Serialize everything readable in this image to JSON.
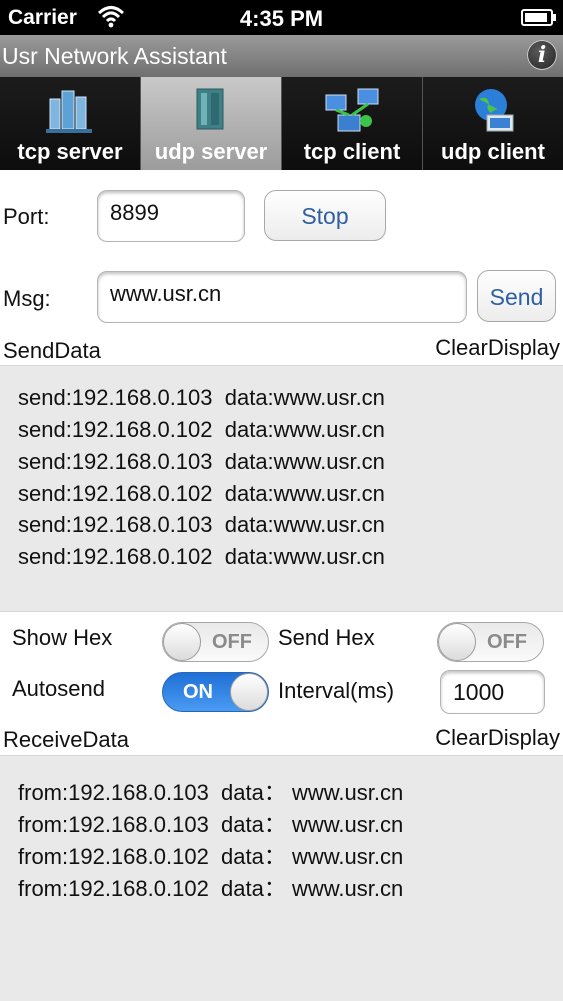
{
  "status": {
    "carrier": "Carrier",
    "time": "4:35 PM"
  },
  "app": {
    "title": "Usr Network Assistant"
  },
  "tabs": [
    {
      "label": "tcp server",
      "icon": "server-rack-icon",
      "active": false
    },
    {
      "label": "udp server",
      "icon": "server-tower-icon",
      "active": true
    },
    {
      "label": "tcp client",
      "icon": "network-computers-icon",
      "active": false
    },
    {
      "label": "udp client",
      "icon": "globe-computer-icon",
      "active": false
    }
  ],
  "form": {
    "port_label": "Port:",
    "port_value": "8899",
    "stop_label": "Stop",
    "msg_label": "Msg:",
    "msg_value": "www.usr.cn",
    "send_label": "Send",
    "send_data_label": "SendData",
    "clear_display_send": "ClearDisplay"
  },
  "send_log": [
    "send:192.168.0.103  data:www.usr.cn",
    "send:192.168.0.102  data:www.usr.cn",
    "send:192.168.0.103  data:www.usr.cn",
    "send:192.168.0.102  data:www.usr.cn",
    "send:192.168.0.103  data:www.usr.cn",
    "send:192.168.0.102  data:www.usr.cn"
  ],
  "options": {
    "show_hex_label": "Show Hex",
    "show_hex_state": "OFF",
    "send_hex_label": "Send Hex",
    "send_hex_state": "OFF",
    "autosend_label": "Autosend",
    "autosend_state": "ON",
    "interval_label": "Interval(ms)",
    "interval_value": "1000"
  },
  "receive": {
    "label": "ReceiveData",
    "clear_display": "ClearDisplay",
    "log": [
      "from:192.168.0.103  data： www.usr.cn",
      "from:192.168.0.103  data： www.usr.cn",
      "from:192.168.0.102  data： www.usr.cn",
      "from:192.168.0.102  data： www.usr.cn"
    ]
  },
  "colors": {
    "accent": "#2f5fa3",
    "toggle_on": "#2a7de6"
  }
}
